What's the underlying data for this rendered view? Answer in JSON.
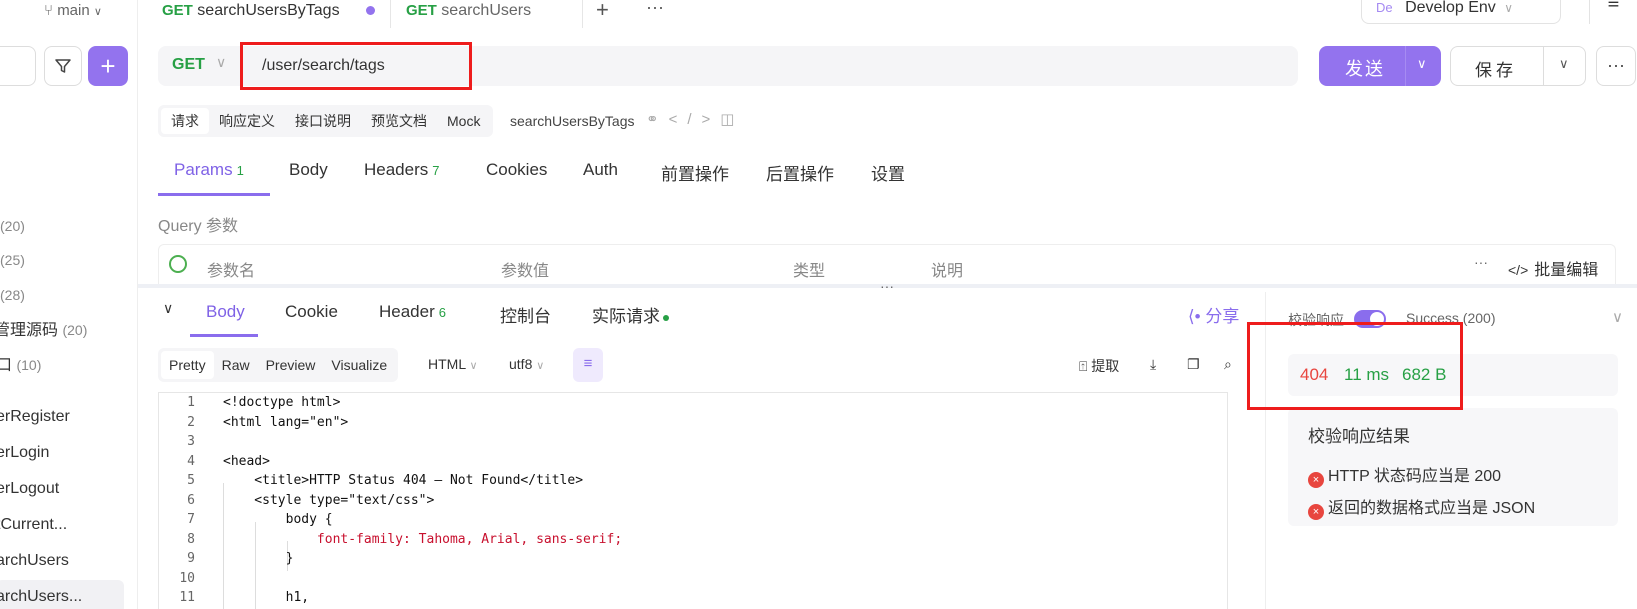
{
  "sidebar": {
    "branch": "main",
    "items": [
      {
        "label": "",
        "count": "(20)"
      },
      {
        "label": "",
        "count": "(25)"
      },
      {
        "label": "",
        "count": "(28)"
      },
      {
        "label": "管理源码",
        "count": "(20)"
      },
      {
        "label": "口",
        "count": "(10)"
      },
      {
        "label": "erRegister",
        "count": ""
      },
      {
        "label": "erLogin",
        "count": ""
      },
      {
        "label": "erLogout",
        "count": ""
      },
      {
        "label": "tCurrent...",
        "count": ""
      },
      {
        "label": "archUsers",
        "count": ""
      },
      {
        "label": "archUsers...",
        "count": ""
      }
    ]
  },
  "tabs": [
    {
      "method": "GET",
      "label": "searchUsersByTags"
    },
    {
      "method": "GET",
      "label": "searchUsers"
    }
  ],
  "env": {
    "badge": "De",
    "label": "Develop Env"
  },
  "request": {
    "method": "GET",
    "url": "/user/search/tags",
    "send_label": "发送",
    "save_label": "保存"
  },
  "subtabs": [
    "请求",
    "响应定义",
    "接口说明",
    "预览文档",
    "Mock"
  ],
  "endpoint_name": "searchUsersByTags",
  "param_tabs": [
    {
      "label": "Params",
      "count": "1"
    },
    {
      "label": "Body",
      "count": ""
    },
    {
      "label": "Headers",
      "count": "7"
    },
    {
      "label": "Cookies",
      "count": ""
    },
    {
      "label": "Auth",
      "count": ""
    },
    {
      "label": "前置操作",
      "count": ""
    },
    {
      "label": "后置操作",
      "count": ""
    },
    {
      "label": "设置",
      "count": ""
    }
  ],
  "query": {
    "label": "Query 参数",
    "columns": [
      "参数名",
      "参数值",
      "类型",
      "说明"
    ],
    "bulk_edit": "批量编辑"
  },
  "response_tabs": [
    {
      "label": "Body",
      "count": ""
    },
    {
      "label": "Cookie",
      "count": ""
    },
    {
      "label": "Header",
      "count": "6"
    },
    {
      "label": "控制台",
      "count": ""
    },
    {
      "label": "实际请求",
      "count": ""
    }
  ],
  "share": "分享",
  "views": [
    "Pretty",
    "Raw",
    "Preview",
    "Visualize"
  ],
  "format": {
    "type": "HTML",
    "encoding": "utf8"
  },
  "tools": {
    "extract": "提取"
  },
  "code_lines": [
    "<!doctype html>",
    "<html lang=\"en\">",
    "",
    "<head>",
    "    <title>HTTP Status 404 – Not Found</title>",
    "    <style type=\"text/css\">",
    "        body {",
    "            font-family: Tahoma, Arial, sans-serif;",
    "        }",
    "",
    "        h1,"
  ],
  "validation": {
    "title": "校验响应",
    "status": "Success (200)",
    "code": "404",
    "time": "11 ms",
    "size": "682 B",
    "result_title": "校验响应结果",
    "errors": [
      "HTTP 状态码应当是 200",
      "返回的数据格式应当是 JSON"
    ]
  },
  "colors": {
    "accent": "#9373ee",
    "method": "#27a045",
    "error": "#e8463f",
    "highlight": "#ee1c1c"
  }
}
